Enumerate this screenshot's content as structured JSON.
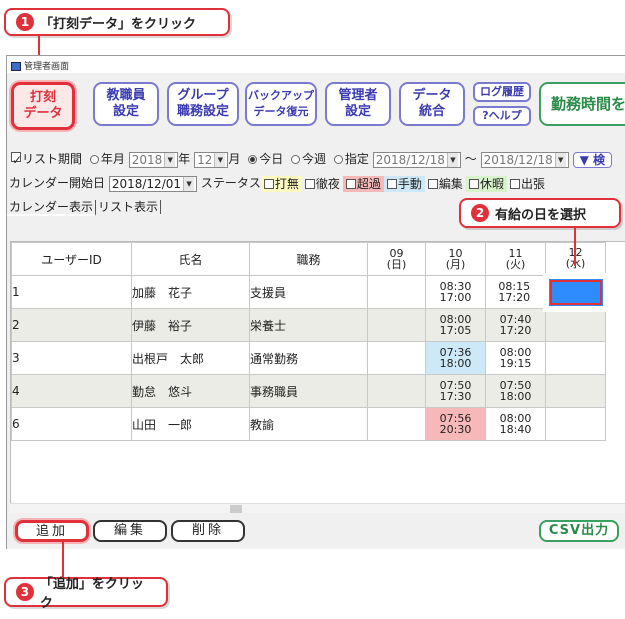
{
  "window": {
    "title": "管理者画面"
  },
  "toolbar": [
    {
      "line1": "打刻",
      "line2": "データ"
    },
    {
      "line1": "教職員",
      "line2": "設定"
    },
    {
      "line1": "グループ",
      "line2": "職務設定"
    },
    {
      "line1": "バックアップ",
      "line2": "データ復元"
    },
    {
      "line1": "管理者",
      "line2": "設定"
    },
    {
      "line1": "データ",
      "line2": "統合"
    }
  ],
  "toolbar_small": [
    "ログ履歴",
    "?ヘルプ"
  ],
  "toolbar_green": "勤務時間を",
  "filters": {
    "list_period": "リスト期間",
    "year_month": "年月",
    "year_value": "2018",
    "year_suffix": "年",
    "month_value": "12",
    "month_suffix": "月",
    "today": "今日",
    "this_week": "今週",
    "specify": "指定",
    "date_from": "2018/12/18",
    "tilde": "〜",
    "date_to": "2018/12/18",
    "search_button": "▼ 検",
    "calendar_start_label": "カレンダー開始日",
    "calendar_start_value": "2018/12/01",
    "status_label": "ステータス",
    "statuses": [
      {
        "label": "打無",
        "color": "#fffbc0"
      },
      {
        "label": "徹夜",
        "color": "#f0f0f0"
      },
      {
        "label": "超過",
        "color": "#f6b8b8"
      },
      {
        "label": "手動",
        "color": "#cde9f7"
      },
      {
        "label": "編集",
        "color": "#f0f0f0"
      },
      {
        "label": "休暇",
        "color": "#d8f2c9"
      },
      {
        "label": "出張",
        "color": "#f0f0f0"
      }
    ]
  },
  "tabs": [
    "カレンダー表示",
    "リスト表示"
  ],
  "table": {
    "headers": [
      "ユーザーID",
      "氏名",
      "職務"
    ],
    "days": [
      {
        "num": "09",
        "dow": "(日)"
      },
      {
        "num": "10",
        "dow": "(月)"
      },
      {
        "num": "11",
        "dow": "(火)"
      },
      {
        "num": "12",
        "dow": "(水)"
      }
    ],
    "rows": [
      {
        "id": "1",
        "name": "加藤　花子",
        "job": "支援員",
        "d10": [
          "08:30",
          "17:00"
        ],
        "d10c": "",
        "d11": [
          "08:15",
          "17:20"
        ],
        "d11c": ""
      },
      {
        "id": "2",
        "name": "伊藤　裕子",
        "job": "栄養士",
        "d10": [
          "08:00",
          "17:05"
        ],
        "d10c": "",
        "d11": [
          "07:40",
          "17:20"
        ],
        "d11c": ""
      },
      {
        "id": "3",
        "name": "出根戸　太郎",
        "job": "通常勤務",
        "d10": [
          "07:36",
          "18:00"
        ],
        "d10c": "#cde9f7",
        "d11": [
          "08:00",
          "19:15"
        ],
        "d11c": ""
      },
      {
        "id": "4",
        "name": "勤怠　悠斗",
        "job": "事務職員",
        "d10": [
          "07:50",
          "17:30"
        ],
        "d10c": "",
        "d11": [
          "07:50",
          "18:00"
        ],
        "d11c": ""
      },
      {
        "id": "6",
        "name": "山田　一郎",
        "job": "教諭",
        "d10": [
          "07:56",
          "20:30"
        ],
        "d10c": "#f6b8b8",
        "d11": [
          "08:00",
          "18:40"
        ],
        "d11c": ""
      }
    ]
  },
  "bottom": {
    "add": "追加",
    "edit": "編集",
    "delete": "削除",
    "csv": "CSV出力"
  },
  "callouts": {
    "c1": {
      "num": "1",
      "text": "「打刻データ」をクリック"
    },
    "c2": {
      "num": "2",
      "text": "有給の日を選択"
    },
    "c3": {
      "num": "3",
      "text": "「追加」をクリック"
    }
  },
  "colors": {
    "accent": "#e0303a",
    "selected_cell": "#2f8cff"
  }
}
